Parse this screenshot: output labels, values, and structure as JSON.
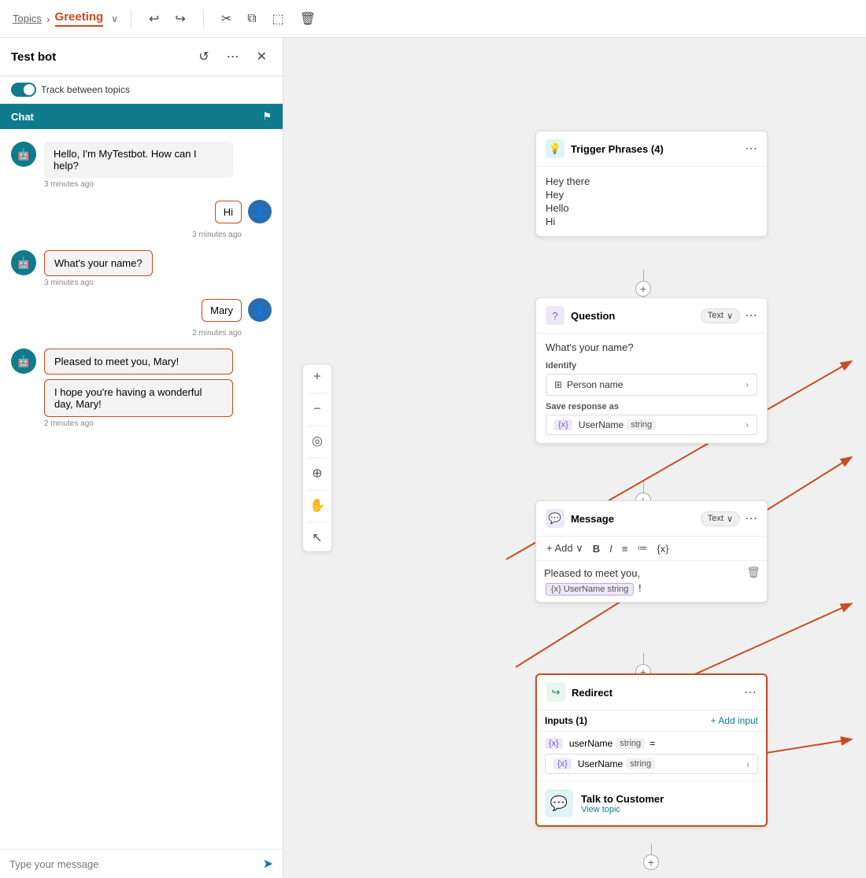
{
  "topbar": {
    "breadcrumb_topics": "Topics",
    "breadcrumb_sep": "›",
    "breadcrumb_current": "Greeting",
    "chevron": "∨",
    "undo": "↩",
    "undo_down": "↪",
    "cut": "✂",
    "copy": "⧉",
    "paste": "⬚",
    "delete": "🗑"
  },
  "leftpanel": {
    "title": "Test bot",
    "close": "✕",
    "toggle_label": "Track between topics",
    "chat_tab": "Chat",
    "chat_flag": "⚑"
  },
  "chat": {
    "messages": [
      {
        "type": "bot",
        "text": "Hello, I'm MyTestbot. How can I help?",
        "time": "3 minutes ago",
        "outlined": false
      },
      {
        "type": "user",
        "text": "Hi",
        "time": "3 minutes ago",
        "outlined": true
      },
      {
        "type": "bot",
        "text": "What's your name?",
        "time": "3 minutes ago",
        "outlined": true
      },
      {
        "type": "user",
        "text": "Mary",
        "time": "2 minutes ago",
        "outlined": false
      },
      {
        "type": "bot",
        "text": "Pleased to meet you, Mary!",
        "time": "2 minutes ago",
        "outlined": true
      },
      {
        "type": "bot2",
        "text": "I hope you're having a wonderful day, Mary!",
        "time": "2 minutes ago",
        "outlined": true
      }
    ],
    "input_placeholder": "Type your message"
  },
  "nodes": {
    "trigger": {
      "title": "Trigger Phrases (4)",
      "phrases": [
        "Hey there",
        "Hey",
        "Hello",
        "Hi"
      ]
    },
    "question": {
      "title": "Question",
      "badge": "Text",
      "question_text": "What's your name?",
      "identify_label": "Identify",
      "entity": "Person name",
      "save_label": "Save response as",
      "var_name": "UserName",
      "var_type": "string"
    },
    "message": {
      "title": "Message",
      "badge": "Text",
      "text1": "Pleased to meet you,",
      "var_name": "UserName",
      "var_type": "string",
      "var_sep": "!"
    },
    "redirect": {
      "title": "Redirect",
      "inputs_label": "Inputs (1)",
      "add_input": "+ Add input",
      "input_var": "userName",
      "input_type": "string",
      "input_eq": "=",
      "ref_var": "UserName",
      "ref_type": "string",
      "talk_title": "Talk to Customer",
      "view_topic": "View topic"
    }
  },
  "zoom": {
    "plus": "+",
    "minus": "−",
    "reset": "◎",
    "fit": "⊕",
    "hand": "✋",
    "cursor": "↖"
  }
}
